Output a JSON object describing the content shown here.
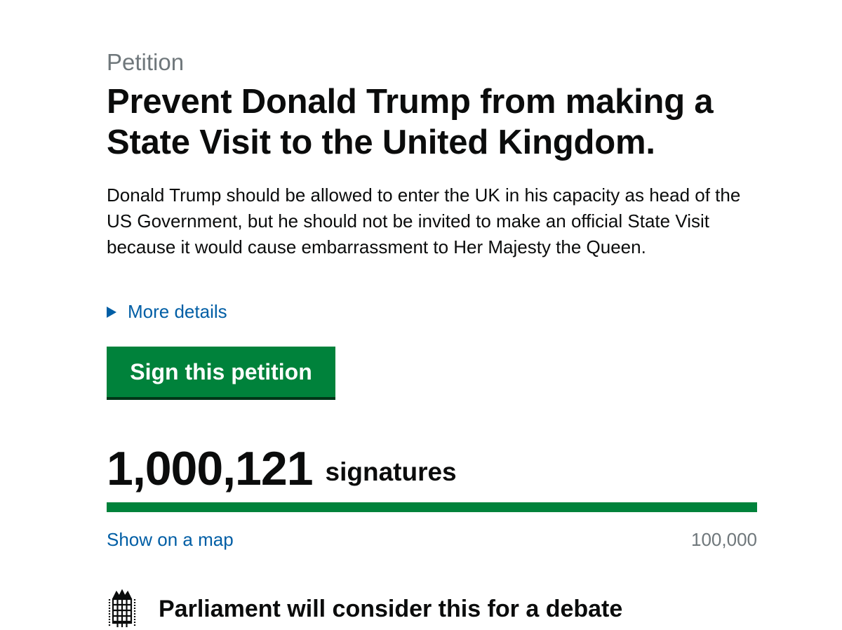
{
  "petition": {
    "kicker": "Petition",
    "title": "Prevent Donald Trump from making a State Visit to the United Kingdom.",
    "summary": "Donald Trump should be allowed to enter the UK in his capacity as head of the US Government, but he should not be invited to make an official State Visit because it would cause embarrassment to Her Majesty the Queen.",
    "more_details_label": "More details",
    "sign_button_label": "Sign this petition"
  },
  "signatures": {
    "count": "1,000,121",
    "label": "signatures",
    "progress_fraction": 1.0,
    "map_link_label": "Show on a map",
    "threshold": "100,000"
  },
  "debate": {
    "icon": "portcullis-icon",
    "text": "Parliament will consider this for a debate"
  },
  "colors": {
    "accent_green": "#00823b",
    "link_blue": "#005ea5",
    "muted_grey": "#6f777b"
  }
}
